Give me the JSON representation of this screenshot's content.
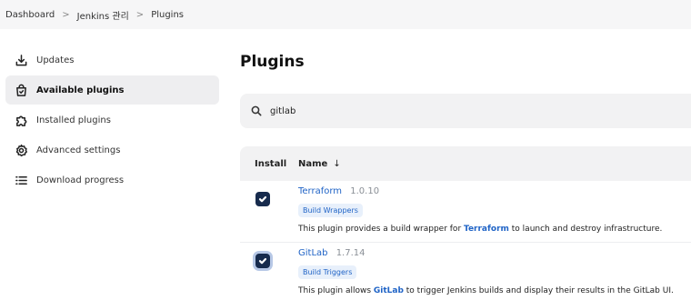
{
  "breadcrumb": {
    "items": [
      "Dashboard",
      "Jenkins 관리",
      "Plugins"
    ],
    "separator": ">"
  },
  "sidebar": {
    "items": [
      {
        "label": "Updates",
        "icon": "download-icon"
      },
      {
        "label": "Available plugins",
        "icon": "shopping-bag-icon",
        "active": true
      },
      {
        "label": "Installed plugins",
        "icon": "puzzle-icon"
      },
      {
        "label": "Advanced settings",
        "icon": "gear-icon"
      },
      {
        "label": "Download progress",
        "icon": "list-icon"
      }
    ]
  },
  "main": {
    "title": "Plugins",
    "search": {
      "value": "gitlab"
    },
    "table": {
      "headers": {
        "install": "Install",
        "name": "Name",
        "sort_indicator": "↓"
      },
      "rows": [
        {
          "name": "Terraform",
          "version": "1.0.10",
          "tag": "Build Wrappers",
          "desc_before": "This plugin provides a build wrapper for ",
          "desc_highlight": "Terraform",
          "desc_after": " to launch and destroy infrastructure.",
          "checked": true
        },
        {
          "name": "GitLab",
          "version": "1.7.14",
          "tag": "Build Triggers",
          "desc_before": "This plugin allows ",
          "desc_highlight": "GitLab",
          "desc_after": " to trigger Jenkins builds and display their results in the GitLab UI.",
          "checked": true
        }
      ]
    }
  },
  "colors": {
    "accent": "#1f63c6",
    "checkbox": "#172b4d",
    "tag_bg": "#e8f0fb"
  }
}
